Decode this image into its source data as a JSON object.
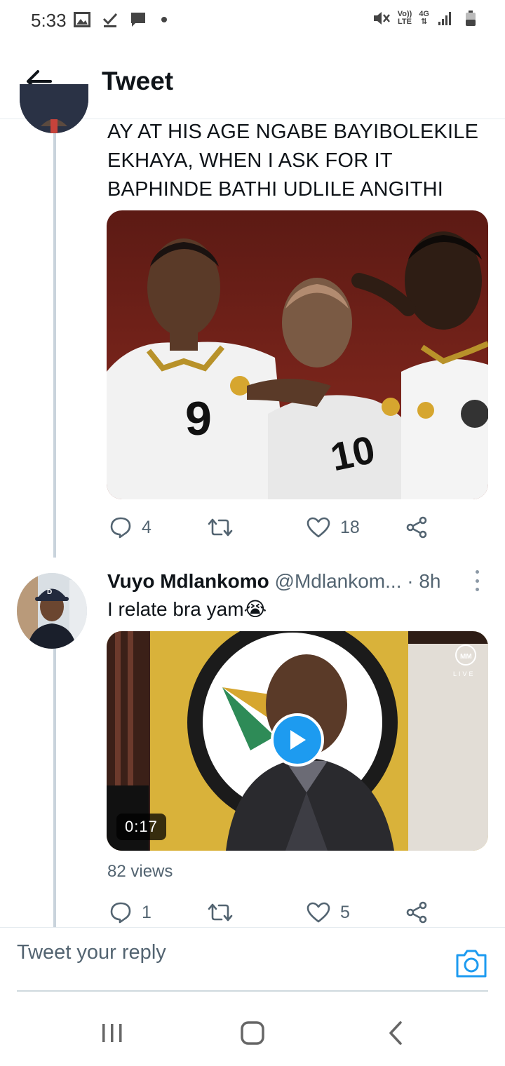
{
  "status_bar": {
    "time": "5:33",
    "volte": "Vo))",
    "lte": "LTE",
    "network": "4G"
  },
  "header": {
    "title": "Tweet"
  },
  "tweet1": {
    "text": "AY AT HIS AGE NGABE BAYIBOLEKILE EKHAYA, WHEN I ASK FOR IT BAPHINDE BATHI UDLILE ANGITHI",
    "image": {
      "jersey_left": "9",
      "jersey_center": "10"
    },
    "reply_count": "4",
    "retweet_count": "",
    "like_count": "18"
  },
  "tweet2": {
    "name": "Vuyo Mdlankomo",
    "handle": "@Mdlankom...",
    "time": "· 8h",
    "text": "I relate bra yam😭",
    "video": {
      "live_label": "LIVE",
      "duration": "0:17"
    },
    "views": "82 views",
    "reply_count": "1",
    "retweet_count": "",
    "like_count": "5"
  },
  "reply_bar": {
    "placeholder": "Tweet your reply"
  },
  "colors": {
    "accent": "#1d9bf0",
    "text_primary": "#0f1419",
    "text_secondary": "#536471",
    "thread_line": "#c9d3dc"
  }
}
